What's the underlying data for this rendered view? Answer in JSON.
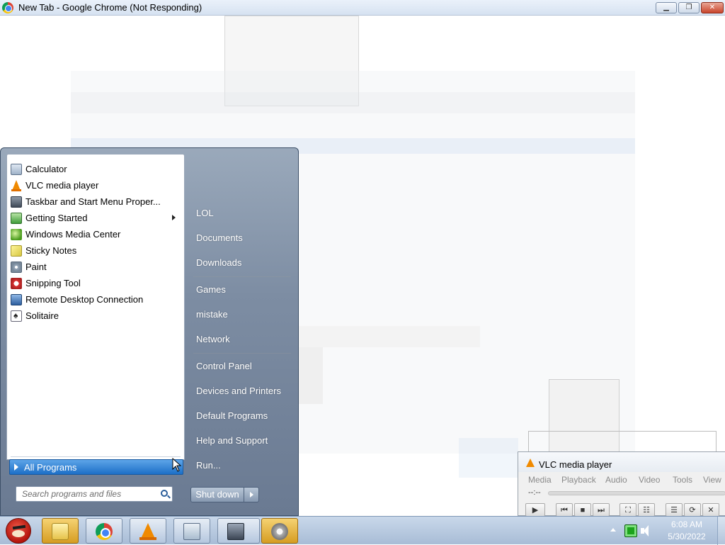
{
  "chrome": {
    "title": "New Tab - Google Chrome (Not Responding)",
    "minimize_glyph": "▁",
    "maximize_glyph": "❐",
    "close_glyph": "✕"
  },
  "start_menu": {
    "programs": [
      {
        "label": "Calculator",
        "icon": "calculator-icon"
      },
      {
        "label": "VLC media player",
        "icon": "vlc-icon"
      },
      {
        "label": "Taskbar and Start Menu Proper...",
        "icon": "taskbar-properties-icon"
      },
      {
        "label": "Getting Started",
        "icon": "getting-started-icon",
        "has_submenu": true
      },
      {
        "label": "Windows Media Center",
        "icon": "windows-media-center-icon"
      },
      {
        "label": "Sticky Notes",
        "icon": "sticky-notes-icon"
      },
      {
        "label": "Paint",
        "icon": "paint-icon"
      },
      {
        "label": "Snipping Tool",
        "icon": "snipping-tool-icon"
      },
      {
        "label": "Remote Desktop Connection",
        "icon": "remote-desktop-icon"
      },
      {
        "label": "Solitaire",
        "icon": "solitaire-icon"
      }
    ],
    "all_programs": "All Programs",
    "search_placeholder": "Search programs and files",
    "right_items": [
      "LOL",
      "Documents",
      "Downloads",
      "Games",
      "mistake",
      "Network",
      "Control Panel",
      "Devices and Printers",
      "Default Programs",
      "Help and Support",
      "Run..."
    ],
    "shutdown": "Shut down"
  },
  "vlc": {
    "title": "VLC media player",
    "menu": [
      "Media",
      "Playback",
      "Audio",
      "Video",
      "Tools",
      "View"
    ],
    "time": "--:--",
    "controls": [
      "play-icon",
      "previous-icon",
      "stop-icon",
      "next-icon",
      "fullscreen-icon",
      "extended-settings-icon",
      "playlist-icon",
      "loop-icon",
      "shuffle-icon"
    ]
  },
  "taskbar": {
    "buttons": [
      "windows-explorer",
      "google-chrome",
      "vlc-media-player",
      "calculator",
      "taskbar-properties",
      "speaker"
    ],
    "clock_time": "6:08 AM",
    "clock_date": "5/30/2022"
  }
}
